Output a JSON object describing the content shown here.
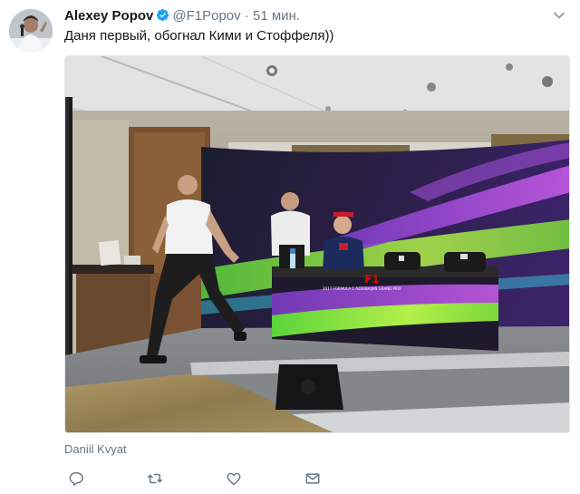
{
  "tweet": {
    "author": {
      "display_name": "Alexey Popov",
      "handle": "@F1Popov",
      "verified": true
    },
    "separator": "·",
    "time": "51 мин.",
    "text": "Даня первый, обогнал Кими и Стоффеля))",
    "media": {
      "backdrop_text": "2017 FORMULA 1 AZERBAIJAN GRAND PRIX",
      "f1_logo_text": "F1"
    },
    "tagged_user": "Daniil Kvyat",
    "actions": [
      {
        "name": "reply",
        "icon": "reply-icon"
      },
      {
        "name": "retweet",
        "icon": "retweet-icon"
      },
      {
        "name": "like",
        "icon": "heart-icon"
      },
      {
        "name": "message",
        "icon": "envelope-icon"
      }
    ]
  },
  "colors": {
    "verified_blue": "#1da1f2",
    "secondary_text": "#657786",
    "icon_gray": "#657786",
    "backdrop_purple": "#5b2a8c",
    "backdrop_green": "#6ad43a"
  }
}
